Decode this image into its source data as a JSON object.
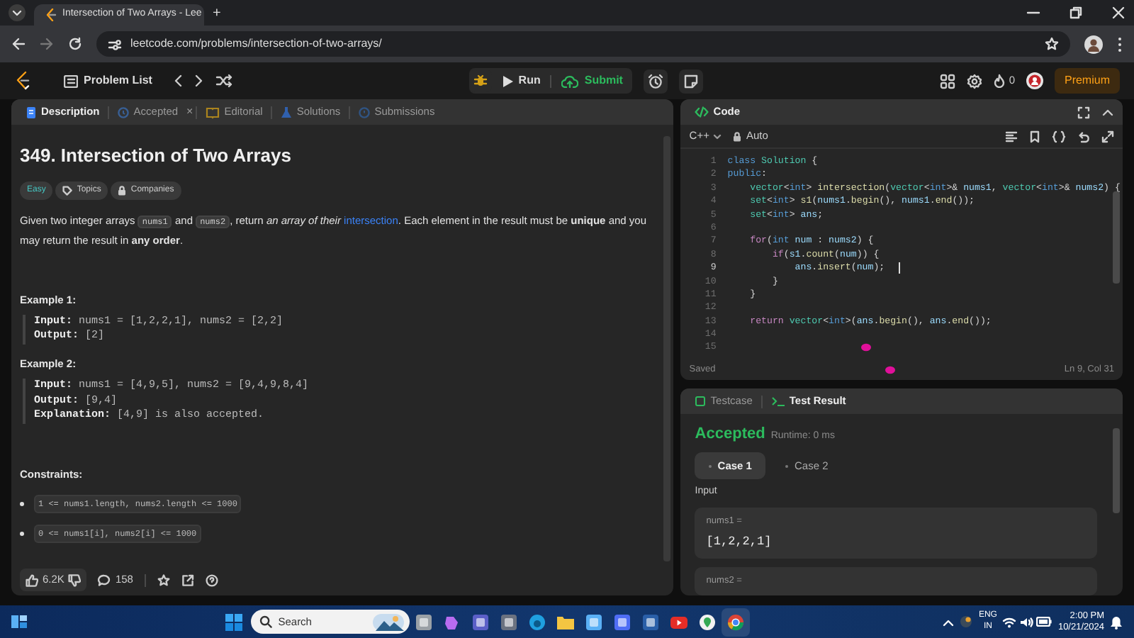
{
  "browser": {
    "tab_title": "Intersection of Two Arrays - Lee",
    "new_tab": "+",
    "url": "leetcode.com/problems/intersection-of-two-arrays/"
  },
  "nav": {
    "problem_list": "Problem List",
    "run": "Run",
    "submit": "Submit",
    "streak": "0",
    "premium": "Premium"
  },
  "description_panel": {
    "tabs": [
      {
        "label": "Description",
        "selected": true
      },
      {
        "label": "Accepted",
        "selected": false,
        "close": "×"
      },
      {
        "label": "Editorial",
        "selected": false
      },
      {
        "label": "Solutions",
        "selected": false
      },
      {
        "label": "Submissions",
        "selected": false
      }
    ],
    "title": "349. Intersection of Two Arrays",
    "tags": [
      {
        "label": "Easy",
        "kind": "difficulty"
      },
      {
        "label": "Topics",
        "kind": "topics"
      },
      {
        "label": "Companies",
        "kind": "companies"
      }
    ],
    "statement": [
      {
        "kind": "text",
        "text": "Given two integer arrays "
      },
      {
        "kind": "code",
        "text": "nums1"
      },
      {
        "kind": "text",
        "text": " and "
      },
      {
        "kind": "code",
        "text": "nums2"
      },
      {
        "kind": "text",
        "text": ", return "
      },
      {
        "kind": "italic",
        "text": "an array of their "
      },
      {
        "kind": "link",
        "text": "intersection"
      },
      {
        "kind": "text",
        "text": ". Each element in the result must be "
      },
      {
        "kind": "bold",
        "text": "unique"
      },
      {
        "kind": "text",
        "text": " and you may return the result in "
      },
      {
        "kind": "bold",
        "text": "any order"
      },
      {
        "kind": "text",
        "text": "."
      }
    ],
    "examples": [
      {
        "heading": "Example 1:",
        "lines": [
          {
            "label": "Input:",
            "value": "nums1 = [1,2,2,1], nums2 = [2,2]"
          },
          {
            "label": "Output:",
            "value": "[2]"
          }
        ]
      },
      {
        "heading": "Example 2:",
        "lines": [
          {
            "label": "Input:",
            "value": "nums1 = [4,9,5], nums2 = [9,4,9,8,4]"
          },
          {
            "label": "Output:",
            "value": "[9,4]"
          },
          {
            "label": "Explanation:",
            "value": "[4,9] is also accepted."
          }
        ]
      }
    ],
    "constraints": {
      "heading": "Constraints:",
      "items": [
        "1 <= nums1.length, nums2.length <= 1000",
        "0 <= nums1[i], nums2[i] <= 1000"
      ]
    },
    "footer": {
      "likes": "6.2K",
      "comments": "158"
    }
  },
  "code_panel": {
    "title": "Code",
    "language": "C++",
    "mode": "Auto",
    "status": "Saved",
    "cursor_position": "Ln 9, Col 31",
    "lines": [
      {
        "number": "1",
        "current": false,
        "tokens": [
          {
            "kind": "kw",
            "text": "class "
          },
          {
            "kind": "type",
            "text": "Solution"
          },
          {
            "kind": "plain",
            "text": " {"
          }
        ]
      },
      {
        "number": "2",
        "current": false,
        "tokens": [
          {
            "kind": "kw",
            "text": "public"
          },
          {
            "kind": "plain",
            "text": ":"
          }
        ]
      },
      {
        "number": "3",
        "current": false,
        "tokens": [
          {
            "kind": "type",
            "text": "    vector"
          },
          {
            "kind": "plain",
            "text": "<"
          },
          {
            "kind": "kw",
            "text": "int"
          },
          {
            "kind": "plain",
            "text": "> "
          },
          {
            "kind": "fn",
            "text": "intersection"
          },
          {
            "kind": "plain",
            "text": "("
          },
          {
            "kind": "type",
            "text": "vector"
          },
          {
            "kind": "plain",
            "text": "<"
          },
          {
            "kind": "kw",
            "text": "int"
          },
          {
            "kind": "plain",
            "text": ">& "
          },
          {
            "kind": "var",
            "text": "nums1"
          },
          {
            "kind": "plain",
            "text": ", "
          },
          {
            "kind": "type",
            "text": "vector"
          },
          {
            "kind": "plain",
            "text": "<"
          },
          {
            "kind": "kw",
            "text": "int"
          },
          {
            "kind": "plain",
            "text": ">& "
          },
          {
            "kind": "var",
            "text": "nums2"
          },
          {
            "kind": "plain",
            "text": ") {"
          }
        ]
      },
      {
        "number": "4",
        "current": false,
        "tokens": [
          {
            "kind": "type",
            "text": "    set"
          },
          {
            "kind": "plain",
            "text": "<"
          },
          {
            "kind": "kw",
            "text": "int"
          },
          {
            "kind": "plain",
            "text": "> "
          },
          {
            "kind": "fn",
            "text": "s1"
          },
          {
            "kind": "plain",
            "text": "("
          },
          {
            "kind": "var",
            "text": "nums1"
          },
          {
            "kind": "plain",
            "text": "."
          },
          {
            "kind": "fn",
            "text": "begin"
          },
          {
            "kind": "plain",
            "text": "(), "
          },
          {
            "kind": "var",
            "text": "nums1"
          },
          {
            "kind": "plain",
            "text": "."
          },
          {
            "kind": "fn",
            "text": "end"
          },
          {
            "kind": "plain",
            "text": "());"
          }
        ]
      },
      {
        "number": "5",
        "current": false,
        "tokens": [
          {
            "kind": "type",
            "text": "    set"
          },
          {
            "kind": "plain",
            "text": "<"
          },
          {
            "kind": "kw",
            "text": "int"
          },
          {
            "kind": "plain",
            "text": "> "
          },
          {
            "kind": "var",
            "text": "ans"
          },
          {
            "kind": "plain",
            "text": ";"
          }
        ]
      },
      {
        "number": "6",
        "current": false
      },
      {
        "number": "7",
        "current": false,
        "tokens": [
          {
            "kind": "ctrl",
            "text": "    for"
          },
          {
            "kind": "plain",
            "text": "("
          },
          {
            "kind": "kw",
            "text": "int "
          },
          {
            "kind": "var",
            "text": "num"
          },
          {
            "kind": "plain",
            "text": " : "
          },
          {
            "kind": "var",
            "text": "nums2"
          },
          {
            "kind": "plain",
            "text": ") {"
          }
        ]
      },
      {
        "number": "8",
        "current": false,
        "tokens": [
          {
            "kind": "ctrl",
            "text": "        if"
          },
          {
            "kind": "plain",
            "text": "("
          },
          {
            "kind": "var",
            "text": "s1"
          },
          {
            "kind": "plain",
            "text": "."
          },
          {
            "kind": "fn",
            "text": "count"
          },
          {
            "kind": "plain",
            "text": "("
          },
          {
            "kind": "var",
            "text": "num"
          },
          {
            "kind": "plain",
            "text": ")) {"
          }
        ]
      },
      {
        "number": "9",
        "current": true,
        "tokens": [
          {
            "kind": "var",
            "text": "            ans"
          },
          {
            "kind": "plain",
            "text": "."
          },
          {
            "kind": "fn",
            "text": "insert"
          },
          {
            "kind": "plain",
            "text": "("
          },
          {
            "kind": "var",
            "text": "num"
          },
          {
            "kind": "plain",
            "text": ");"
          }
        ]
      },
      {
        "number": "10",
        "current": false,
        "tokens": [
          {
            "kind": "plain",
            "text": "        }"
          }
        ]
      },
      {
        "number": "11",
        "current": false,
        "tokens": [
          {
            "kind": "plain",
            "text": "    }"
          }
        ]
      },
      {
        "number": "12",
        "current": false
      },
      {
        "number": "13",
        "current": false,
        "tokens": [
          {
            "kind": "ctrl",
            "text": "    return "
          },
          {
            "kind": "type",
            "text": "vector"
          },
          {
            "kind": "plain",
            "text": "<"
          },
          {
            "kind": "kw",
            "text": "int"
          },
          {
            "kind": "plain",
            "text": ">("
          },
          {
            "kind": "var",
            "text": "ans"
          },
          {
            "kind": "plain",
            "text": "."
          },
          {
            "kind": "fn",
            "text": "begin"
          },
          {
            "kind": "plain",
            "text": "(), "
          },
          {
            "kind": "var",
            "text": "ans"
          },
          {
            "kind": "plain",
            "text": "."
          },
          {
            "kind": "fn",
            "text": "end"
          },
          {
            "kind": "plain",
            "text": "());"
          }
        ]
      },
      {
        "number": "14",
        "current": false
      },
      {
        "number": "15",
        "current": false
      }
    ]
  },
  "test_panel": {
    "tabs": [
      {
        "label": "Testcase",
        "selected": false
      },
      {
        "label": "Test Result",
        "selected": true
      }
    ],
    "verdict": "Accepted",
    "runtime": "Runtime: 0 ms",
    "cases": [
      {
        "label": "Case 1",
        "selected": true
      },
      {
        "label": "Case 2",
        "selected": false
      }
    ],
    "input_label": "Input",
    "inputs": [
      {
        "name": "nums1 =",
        "value": "[1,2,2,1]"
      },
      {
        "name": "nums2 ="
      }
    ]
  },
  "taskbar": {
    "search": "Search",
    "language": "ENG",
    "region": "IN",
    "time": "2:00 PM",
    "date": "10/21/2024"
  }
}
